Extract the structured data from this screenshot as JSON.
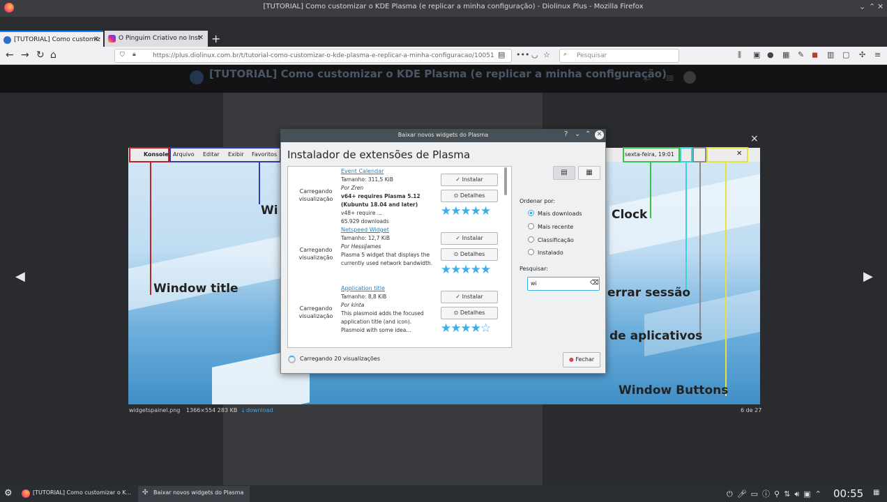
{
  "browser": {
    "window_title": "[TUTORIAL] Como customizar o KDE Plasma (e replicar a minha configuração) - Diolinux Plus - Mozilla Firefox",
    "tabs": [
      {
        "label": "[TUTORIAL] Como customiz",
        "icon": "diolinux-icon",
        "active": true
      },
      {
        "label": "O Pinguim Criativo no Inst",
        "icon": "instagram-icon",
        "active": false
      }
    ],
    "new_tab": "+",
    "url": "https://plus.diolinux.com.br/t/tutorial-como-customizar-o-kde-plasma-e-replicar-a-minha-configuracao/10051",
    "search_placeholder": "Pesquisar"
  },
  "page": {
    "header_title": "[TUTORIAL] Como customizar o KDE Plasma (e replicar a minha configuração)"
  },
  "lightbox": {
    "panel_menu": [
      "Konsole",
      "Arquivo",
      "Editar",
      "Exibir",
      "Favoritos"
    ],
    "panel_clock": "sexta-feira, 19:01",
    "annotations": {
      "window_title": "Window title",
      "window_menu": "Wi",
      "clock": "Clock",
      "logout": "errar sessão",
      "apps": "de aplicativos",
      "window_buttons": "Window Buttons"
    },
    "caption_file": "widgetspainel.png",
    "caption_meta": "1366×554 283 KB",
    "caption_download": "download",
    "counter": "6 de 27",
    "close": "×",
    "prev": "◀",
    "next": "▶"
  },
  "dialog": {
    "title": "Baixar novos widgets do Plasma",
    "heading": "Instalador de extensões de Plasma",
    "items": [
      {
        "loading": "Carregando visualização",
        "name": "Event Calendar",
        "size": "Tamanho: 311,5 KiB",
        "author": "Por Zren",
        "desc1": "v64+ requires Plasma 5.12 (Kubuntu 18.04 and later)",
        "desc2": "v48+ require ...",
        "downloads": "65.929 downloads",
        "install": "✓ Instalar",
        "details": "⊙ Detalhes",
        "stars": "★★★★★"
      },
      {
        "loading": "Carregando visualização",
        "name": "Netspeed Widget",
        "size": "Tamanho: 12,7 KiB",
        "author": "Por HessiJames",
        "desc1": "Plasma 5 widget that displays the currently used network bandwidth.",
        "install": "✓ Instalar",
        "details": "⊙ Detalhes",
        "stars": "★★★★★"
      },
      {
        "loading": "Carregando visualização",
        "name": "Application title",
        "size": "Tamanho: 8,8 KiB",
        "author": "Por kinta",
        "desc1": "This plasmoid adds the focused application title (and icon).",
        "desc2": "Plasmoid with some idea...",
        "install": "✓ Instalar",
        "details": "⊙ Detalhes",
        "stars": "★★★★☆"
      }
    ],
    "sort_label": "Ordenar por:",
    "sort_options": [
      "Mais downloads",
      "Mais recente",
      "Classificação",
      "Instalado"
    ],
    "sort_selected": "Mais downloads",
    "search_label": "Pesquisar:",
    "search_value": "wi",
    "loading_status": "Carregando 20 visualizações",
    "close_button": "Fechar"
  },
  "taskbar": {
    "tasks": [
      "[TUTORIAL] Como customizar o K...",
      "Baixar novos widgets do Plasma"
    ],
    "clock": "00:55"
  },
  "colors": {
    "accent": "#3daee9",
    "link": "#2980b9",
    "firefox_accent": "#0a84ff"
  }
}
